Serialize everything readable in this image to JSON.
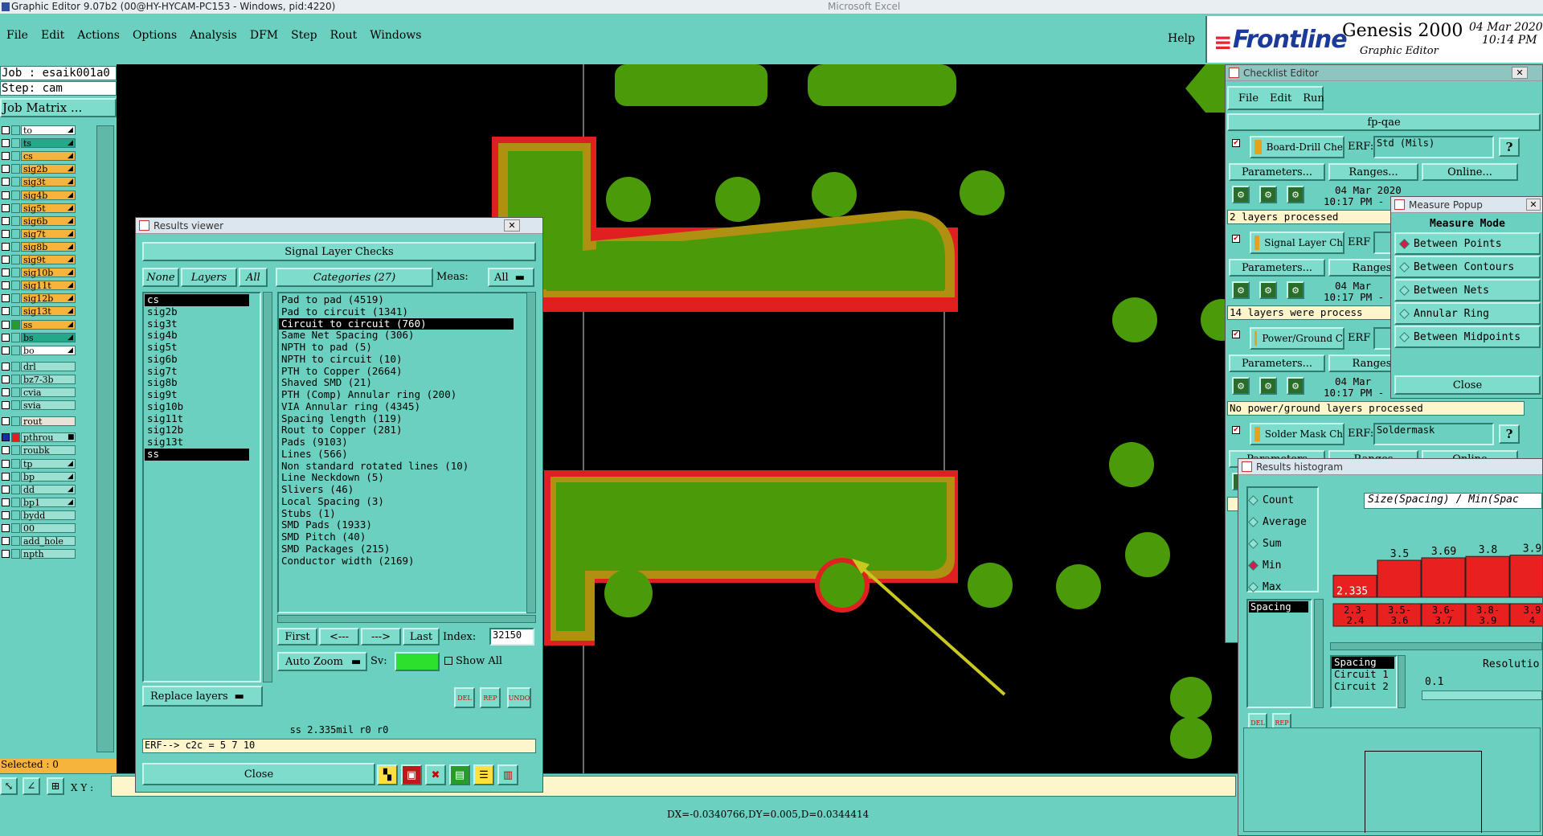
{
  "app": {
    "title": "Graphic Editor 9.07b2 (00@HY-HYCAM-PC153 - Windows, pid:4220)",
    "bg_title": "Microsoft Excel",
    "menu": [
      "File",
      "Edit",
      "Actions",
      "Options",
      "Analysis",
      "DFM",
      "Step",
      "Rout",
      "Windows"
    ],
    "help": "Help"
  },
  "brand": {
    "logo": "Frontline",
    "product": "Genesis 2000",
    "subtitle": "Graphic Editor",
    "date": "04 Mar 2020",
    "time": "10:14 PM"
  },
  "left": {
    "job": "Job : esaik001a0",
    "step": "Step: cam",
    "job_matrix": "Job Matrix ...",
    "layers": [
      {
        "name": "to",
        "color": "#ffffff",
        "icon": "◢"
      },
      {
        "name": "ts",
        "color": "#23a88a",
        "icon": "◢"
      },
      {
        "name": "cs",
        "color": "#f7b43c",
        "icon": "◢"
      },
      {
        "name": "sig2b",
        "color": "#f7b43c",
        "icon": "◢"
      },
      {
        "name": "sig3t",
        "color": "#f7b43c",
        "icon": "◢"
      },
      {
        "name": "sig4b",
        "color": "#f7b43c",
        "icon": "◢"
      },
      {
        "name": "sig5t",
        "color": "#f7b43c",
        "icon": "◢"
      },
      {
        "name": "sig6b",
        "color": "#f7b43c",
        "icon": "◢"
      },
      {
        "name": "sig7t",
        "color": "#f7b43c",
        "icon": "◢"
      },
      {
        "name": "sig8b",
        "color": "#f7b43c",
        "icon": "◢"
      },
      {
        "name": "sig9t",
        "color": "#f7b43c",
        "icon": "◢"
      },
      {
        "name": "sig10b",
        "color": "#f7b43c",
        "icon": "◢"
      },
      {
        "name": "sig11t",
        "color": "#f7b43c",
        "icon": "◢"
      },
      {
        "name": "sig12b",
        "color": "#f7b43c",
        "icon": "◢"
      },
      {
        "name": "sig13t",
        "color": "#f7b43c",
        "icon": "◢"
      },
      {
        "name": "ss",
        "color": "#f7b43c",
        "icon": "◢"
      },
      {
        "name": "bs",
        "color": "#23a88a",
        "icon": "◢"
      },
      {
        "name": "bo",
        "color": "#ffffff",
        "icon": "◢"
      },
      {
        "name": "drl",
        "color": "#9be0d2",
        "icon": ""
      },
      {
        "name": "bz7-3b",
        "color": "#9be0d2",
        "icon": ""
      },
      {
        "name": "cvia",
        "color": "#9be0d2",
        "icon": ""
      },
      {
        "name": "svia",
        "color": "#9be0d2",
        "icon": ""
      },
      {
        "name": "rout",
        "color": "#e8e2d8",
        "icon": ""
      },
      {
        "name": "pthrou",
        "color": "#9be0d2",
        "icon": "■"
      },
      {
        "name": "roubk",
        "color": "#9be0d2",
        "icon": ""
      },
      {
        "name": "tp",
        "color": "#9be0d2",
        "icon": "◢"
      },
      {
        "name": "bp",
        "color": "#9be0d2",
        "icon": "◢"
      },
      {
        "name": "dd",
        "color": "#9be0d2",
        "icon": "◢"
      },
      {
        "name": "bp1",
        "color": "#9be0d2",
        "icon": "◢"
      },
      {
        "name": "bydd",
        "color": "#9be0d2",
        "icon": ""
      },
      {
        "name": "00",
        "color": "#9be0d2",
        "icon": ""
      },
      {
        "name": "add_hole",
        "color": "#9be0d2",
        "icon": ""
      },
      {
        "name": "npth",
        "color": "#9be0d2",
        "icon": ""
      }
    ],
    "selected": "Selected : 0",
    "xy_label": "X Y :"
  },
  "results_viewer": {
    "title": "Results viewer",
    "heading": "Signal Layer Checks",
    "none": "None",
    "layers": "Layers",
    "all": "All",
    "categories_btn": "Categories (27)",
    "meas_label": "Meas:",
    "meas_value": "All",
    "layer_list": [
      "cs",
      "sig2b",
      "sig3t",
      "sig4b",
      "sig5t",
      "sig6b",
      "sig7t",
      "sig8b",
      "sig9t",
      "sig10b",
      "sig11t",
      "sig12b",
      "sig13t",
      "ss"
    ],
    "categories": [
      "Pad to pad (4519)",
      "Pad to circuit (1341)",
      "Circuit to circuit (760)",
      "Same Net Spacing (306)",
      "NPTH to pad (5)",
      "NPTH to circuit (10)",
      "PTH to Copper (2664)",
      "Shaved SMD (21)",
      "PTH (Comp) Annular ring (200)",
      "VIA Annular ring (4345)",
      "Spacing length (119)",
      "Rout to Copper (281)",
      "Pads (9103)",
      "Lines (566)",
      "Non standard rotated lines (10)",
      "Line Neckdown (5)",
      "Slivers (46)",
      "Local Spacing (3)",
      "Stubs (1)",
      "SMD Pads (1933)",
      "SMD Pitch (40)",
      "SMD Packages (215)",
      "Conductor width (2169)"
    ],
    "first": "First",
    "prev": "<---",
    "next": "--->",
    "last": "Last",
    "index_label": "Index:",
    "index_value": "32150",
    "auto_zoom": "Auto Zoom",
    "sv_label": "Sv:",
    "show_all": "Show All",
    "replace_layers": "Replace layers",
    "del": "DEL",
    "rep": "REP",
    "undo": "UNDO",
    "status": "ss 2.335mil  r0  r0",
    "erf": "ERF--> c2c = 5 7 10",
    "close": "Close"
  },
  "checklist": {
    "title": "Checklist Editor",
    "menu": [
      "File",
      "Edit",
      "Run"
    ],
    "name": "fp-qae",
    "items": [
      {
        "label": "Board-Drill Che",
        "erf": "ERF:",
        "erf_value": "Std (Mils)",
        "params": "Parameters...",
        "ranges": "Ranges...",
        "online": "Online...",
        "date": "04 Mar 2020",
        "time": "10:17 PM -",
        "status": "2 layers processed",
        "status_bg": "#fdf5cc"
      },
      {
        "label": "Signal Layer Ch",
        "erf": "ERF",
        "erf_value": "",
        "params": "Parameters...",
        "ranges": "Ranges.",
        "online": "",
        "date": "04 Mar",
        "time": "10:17 PM -",
        "status": "14 layers were process",
        "status_bg": "#fdf5cc"
      },
      {
        "label": "Power/Ground C",
        "erf": "ERF",
        "erf_value": "",
        "params": "Parameters...",
        "ranges": "Ranges.",
        "online": "",
        "date": "04 Mar",
        "time": "10:17 PM -",
        "status": "No power/ground layers processed",
        "status_bg": "#fdf5cc"
      },
      {
        "label": "Solder Mask Ch",
        "erf": "ERF:",
        "erf_value": "Soldermask",
        "params": "Parameters",
        "ranges": "Ranges",
        "online": "Online",
        "date": "",
        "time": "",
        "status": "",
        "status_bg": "#fdf5cc"
      }
    ],
    "q": "?"
  },
  "measure": {
    "title": "Measure Popup",
    "heading": "Measure Mode",
    "options": [
      "Between Points",
      "Between Contours",
      "Between Nets",
      "Annular Ring",
      "Between Midpoints"
    ],
    "close": "Close"
  },
  "histogram": {
    "title": "Results histogram",
    "stats": [
      "Count",
      "Average",
      "Sum",
      "Min",
      "Max"
    ],
    "selected_stat": "Min",
    "list_item": "Spacing",
    "header": "Size(Spacing) / Min(Spac",
    "bars": [
      {
        "label": "2.3-\n2.4",
        "value": 2.335,
        "value_label": "2.335"
      },
      {
        "label": "3.5-\n3.6",
        "value": 3.5,
        "value_label": "3.5"
      },
      {
        "label": "3.6-\n3.7",
        "value": 3.69,
        "value_label": "3.69"
      },
      {
        "label": "3.8-\n3.9",
        "value": 3.8,
        "value_label": "3.8"
      },
      {
        "label": "3.9\n4",
        "value": 3.9,
        "value_label": "3.9"
      }
    ],
    "list2": [
      "Spacing",
      "Circuit 1",
      "Circuit 2"
    ],
    "resolution_label": "Resolutio",
    "resolution_value": "0.1",
    "del": "DEL",
    "rep": "REP"
  },
  "canvas": {
    "bg": "#000000",
    "copper": "#4a9a0a",
    "clearance": "#e02020",
    "outline": "#b09010",
    "arrow": "#c8c820"
  },
  "bottom": {
    "status": "DX=-0.0340766,DY=0.005,D=0.0344414"
  }
}
